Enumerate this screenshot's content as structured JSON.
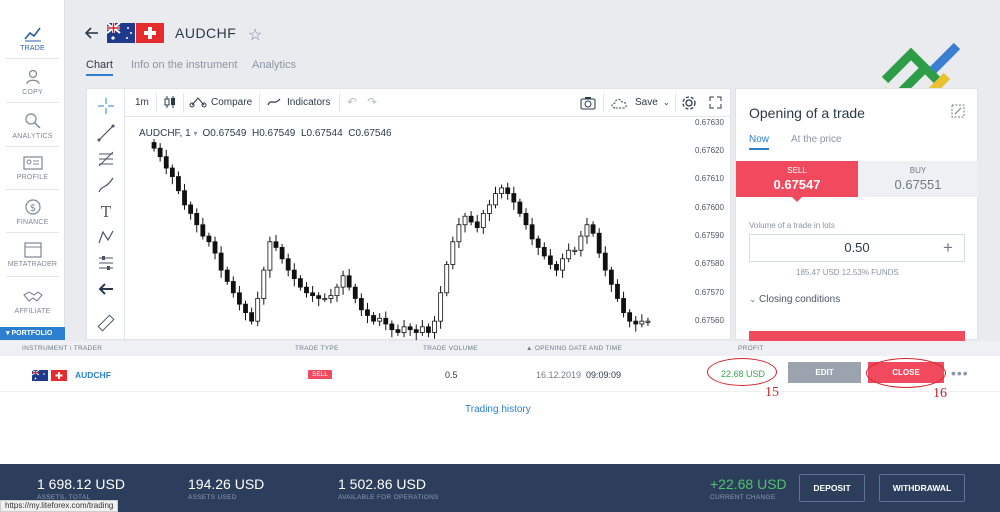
{
  "nav": {
    "items": [
      {
        "label": "TRADE",
        "icon": "chart-line-icon"
      },
      {
        "label": "COPY",
        "icon": "copy-user-icon"
      },
      {
        "label": "ANALYTICS",
        "icon": "analytics-icon"
      },
      {
        "label": "PROFILE",
        "icon": "id-card-icon"
      },
      {
        "label": "FINANCE",
        "icon": "dollar-coin-icon"
      },
      {
        "label": "METATRADER",
        "icon": "window-icon"
      },
      {
        "label": "AFFILIATE",
        "icon": "handshake-icon"
      }
    ],
    "portfolio": "▾ PORTFOLIO"
  },
  "header": {
    "symbol": "AUDCHF",
    "tabs": [
      "Chart",
      "Info on the instrument",
      "Analytics"
    ]
  },
  "chart": {
    "interval": "1m",
    "compare": "Compare",
    "indicators": "Indicators",
    "save": "Save",
    "legend": {
      "symbol": "AUDCHF, 1",
      "o": "O0.67549",
      "h": "H0.67549",
      "l": "L0.67544",
      "c": "C0.67546"
    },
    "price_ticks": [
      "0.67630",
      "0.67620",
      "0.67610",
      "0.67600",
      "0.67590",
      "0.67580",
      "0.67570",
      "0.67560"
    ]
  },
  "chart_data": {
    "type": "candlestick",
    "symbol": "AUDCHF",
    "interval": "1",
    "ylim": [
      0.67553,
      0.67632
    ],
    "close_series": [
      0.67621,
      0.67618,
      0.67614,
      0.67611,
      0.67606,
      0.67601,
      0.67598,
      0.67594,
      0.6759,
      0.67588,
      0.67584,
      0.67578,
      0.67574,
      0.6757,
      0.67566,
      0.67563,
      0.6756,
      0.67568,
      0.67578,
      0.67588,
      0.67586,
      0.67582,
      0.67578,
      0.67575,
      0.67572,
      0.6757,
      0.67569,
      0.67568,
      0.67568,
      0.67569,
      0.67572,
      0.67576,
      0.67572,
      0.67568,
      0.67564,
      0.67562,
      0.6756,
      0.67561,
      0.67559,
      0.67557,
      0.67556,
      0.67558,
      0.67557,
      0.67556,
      0.67558,
      0.67556,
      0.6756,
      0.6757,
      0.6758,
      0.67588,
      0.67594,
      0.67597,
      0.67595,
      0.67593,
      0.67598,
      0.67601,
      0.67605,
      0.67607,
      0.67605,
      0.67602,
      0.67598,
      0.67594,
      0.67589,
      0.67586,
      0.67583,
      0.6758,
      0.67578,
      0.67582,
      0.67585,
      0.67585,
      0.6759,
      0.67594,
      0.67591,
      0.67584,
      0.67578,
      0.67573,
      0.67568,
      0.67563,
      0.6756,
      0.67559,
      0.6756,
      0.6756
    ],
    "last": {
      "open": 0.67549,
      "high": 0.67549,
      "low": 0.67544,
      "close": 0.67546
    }
  },
  "trade_panel": {
    "title": "Opening of a trade",
    "tabs": [
      "Now",
      "At the price"
    ],
    "sell_label": "SELL",
    "sell_price": "0.67547",
    "buy_label": "BUY",
    "buy_price": "0.67551",
    "volume_label": "Volume of a trade in lots",
    "volume_value": "0.50",
    "volume_info": "185.47 USD   12.53% FUNDS",
    "closing_conditions": "Closing conditions"
  },
  "positions": {
    "headers": [
      "INSTRUMENT \\ TRADER",
      "TRADE TYPE",
      "TRADE VOLUME",
      "▲ OPENING DATE AND TIME",
      "PROFIT"
    ],
    "row": {
      "symbol": "AUDCHF",
      "type": "SELL",
      "volume": "0.5",
      "date": "16.12.2019",
      "time": "09:09:09",
      "profit": "22.68 USD",
      "edit": "EDIT",
      "close": "CLOSE"
    },
    "annotations": [
      "15",
      "16"
    ],
    "history_link": "Trading history"
  },
  "footer": {
    "assets_total": {
      "value": "1 698.12 USD",
      "label": "ASSETS, TOTAL"
    },
    "assets_used": {
      "value": "194.26 USD",
      "label": "ASSETS USED"
    },
    "available": {
      "value": "1 502.86 USD",
      "label": "AVAILABLE FOR OPERATIONS"
    },
    "current_change": {
      "value": "+22.68 USD",
      "label": "CURRENT CHANGE"
    },
    "deposit": "DEPOSIT",
    "withdrawal": "WITHDRAWAL"
  },
  "status_url": "https://my.liteforex.com/trading",
  "colors": {
    "sell": "#f1495d",
    "accent": "#2d7fd0",
    "footer": "#2c3e5c",
    "profit": "#3aa64f"
  }
}
